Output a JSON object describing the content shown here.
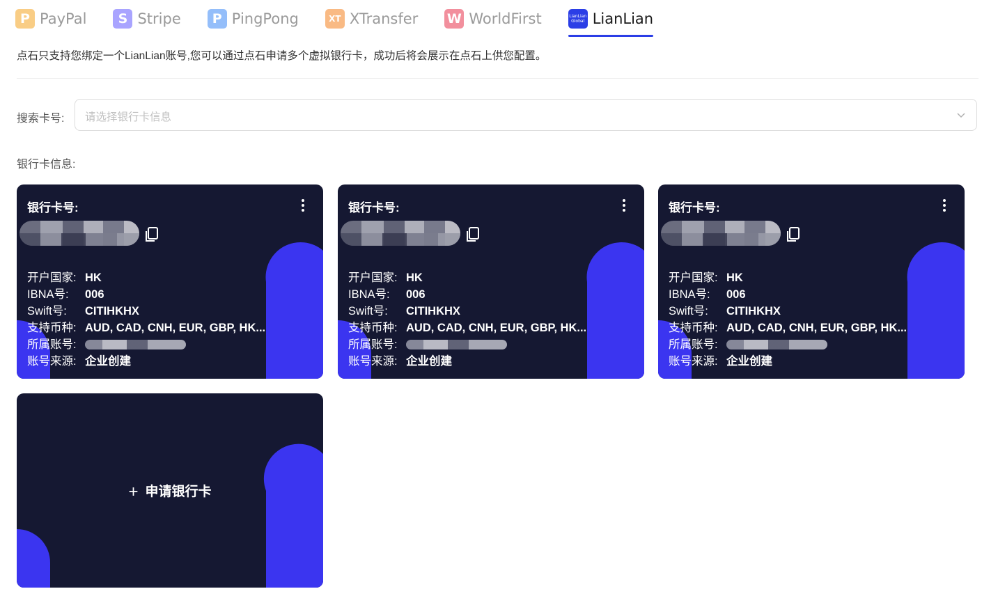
{
  "tabs": [
    {
      "label": "PayPal",
      "logo_text": "P",
      "color": "#f5a623",
      "icon": "paypal-logo"
    },
    {
      "label": "Stripe",
      "logo_text": "S",
      "color": "#635bff",
      "icon": "stripe-logo"
    },
    {
      "label": "PingPong",
      "logo_text": "P",
      "color": "#3d8af7",
      "icon": "pingpong-logo"
    },
    {
      "label": "XTransfer",
      "logo_text": "XT",
      "color": "#f58220",
      "icon": "xtransfer-logo"
    },
    {
      "label": "WorldFirst",
      "logo_text": "W",
      "color": "#e8344e",
      "icon": "worldfirst-logo"
    },
    {
      "label": "LianLian",
      "logo_text": "LianLian Global",
      "color": "#2b3ee6",
      "icon": "lianlian-logo",
      "active": true
    }
  ],
  "notice": "点石只支持您绑定一个LianLian账号,您可以通过点石申请多个虚拟银行卡，成功后将会展示在点石上供您配置。",
  "search": {
    "label": "搜索卡号:",
    "placeholder": "请选择银行卡信息"
  },
  "section_label": "银行卡信息:",
  "card_labels": {
    "card_number": "银行卡号:",
    "country": "开户国家:",
    "ibna": "IBNA号:",
    "swift": "Swift号:",
    "currencies": "支持币种:",
    "account": "所属账号:",
    "source": "账号来源:"
  },
  "cards": [
    {
      "country": "HK",
      "ibna": "006",
      "swift": "CITIHKHX",
      "currencies": "AUD, CAD, CNH, EUR, GBP, HK...",
      "source": "企业创建"
    },
    {
      "country": "HK",
      "ibna": "006",
      "swift": "CITIHKHX",
      "currencies": "AUD, CAD, CNH, EUR, GBP, HK...",
      "source": "企业创建"
    },
    {
      "country": "HK",
      "ibna": "006",
      "swift": "CITIHKHX",
      "currencies": "AUD, CAD, CNH, EUR, GBP, HK...",
      "source": "企业创建"
    }
  ],
  "apply_card": {
    "label": "申请银行卡",
    "icon": "plus-icon"
  },
  "colors": {
    "card_bg": "#151832",
    "accent_blue": "#3b35f0",
    "accent_dark_blue": "#2a2a8c",
    "tab_active": "#2b3ee6"
  }
}
